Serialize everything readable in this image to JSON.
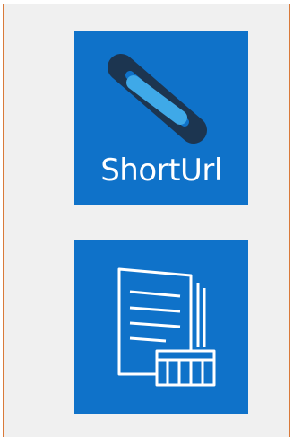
{
  "tiles": [
    {
      "label": "ShortUrl",
      "icon": "chain-link-icon",
      "background": "#0f72c9"
    },
    {
      "label": "",
      "icon": "document-table-icon",
      "background": "#0f72c9"
    }
  ],
  "colors": {
    "panel_background": "#f0f0f0",
    "panel_border": "#d97a3a",
    "tile_background": "#0f72c9",
    "link_dark": "#1c3550",
    "link_light": "#3fa9e8",
    "icon_stroke": "#ffffff"
  }
}
